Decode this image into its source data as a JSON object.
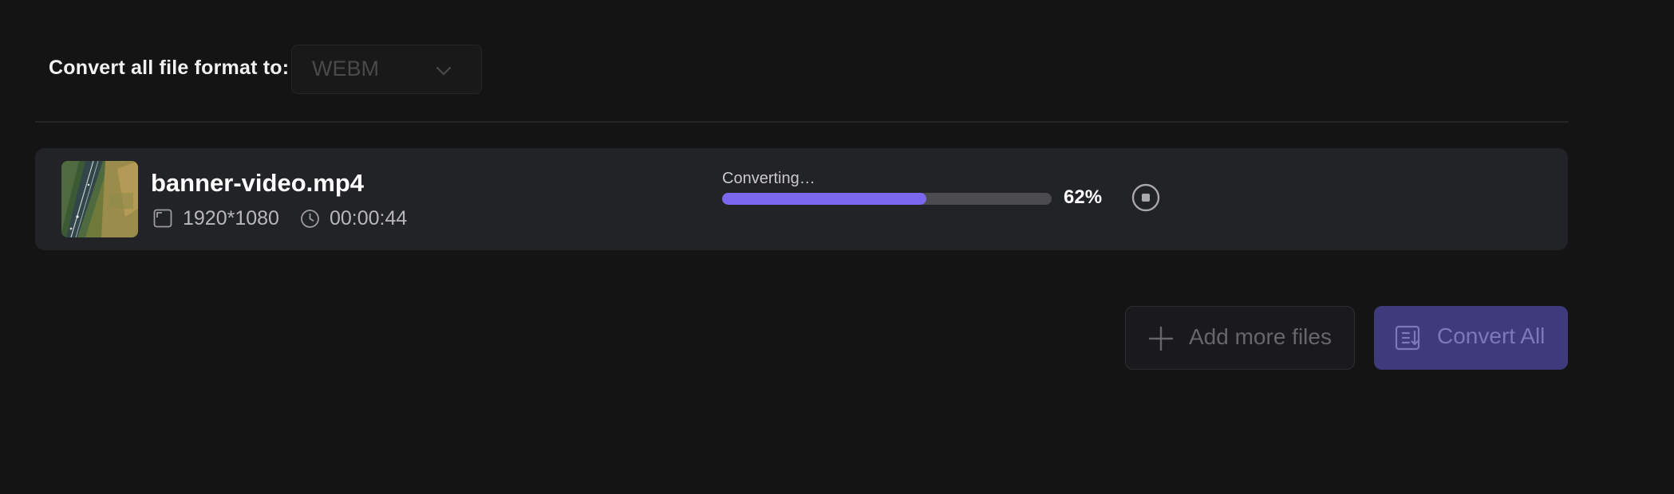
{
  "header": {
    "format_label": "Convert all file format to:",
    "format_select": {
      "value": "WEBM",
      "icon": "chevron-down-icon"
    }
  },
  "file": {
    "name": "banner-video.mp4",
    "resolution": "1920*1080",
    "duration": "00:00:44",
    "status": "Converting…",
    "progress": 0.62,
    "progress_text": "62%",
    "icons": {
      "resolution": "resolution-frame-icon",
      "duration": "clock-icon",
      "stop": "stop-circle-icon"
    }
  },
  "actions": {
    "add_files_label": "Add more files",
    "convert_all_label": "Convert All"
  },
  "colors": {
    "background": "#141415",
    "card": "#222326",
    "accent": "#7b68ee",
    "accent_disabled": "#3f3a7c",
    "progress_track": "#4b4b50"
  }
}
